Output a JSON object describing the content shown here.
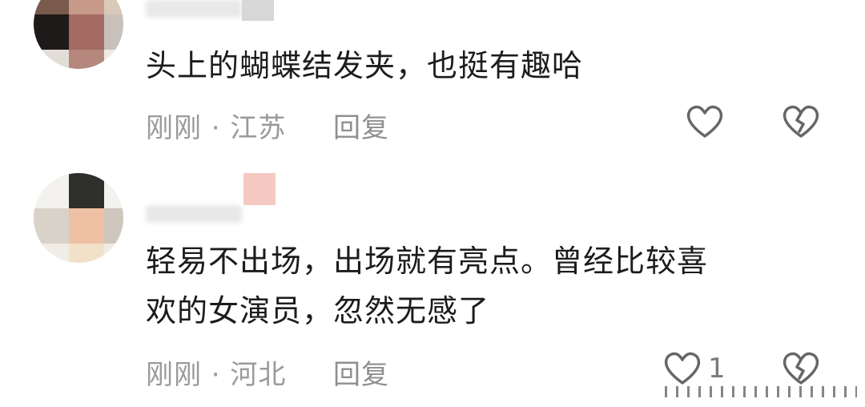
{
  "comments": [
    {
      "text": "头上的蝴蝶结发夹，也挺有趣哈",
      "meta": "刚刚 · 江苏",
      "reply_label": "回复",
      "like_count": ""
    },
    {
      "text_line1": "轻易不出场，出场就有亮点。曾经比较喜",
      "text_line2": "欢的女演员，忽然无感了",
      "meta": "刚刚 · 河北",
      "reply_label": "回复",
      "like_count": "1"
    }
  ],
  "icons": {
    "like": "heart-outline-icon",
    "dislike": "broken-heart-icon"
  },
  "colors": {
    "text": "#1c1c1c",
    "meta": "#9a9a9a",
    "icon": "#666666"
  }
}
